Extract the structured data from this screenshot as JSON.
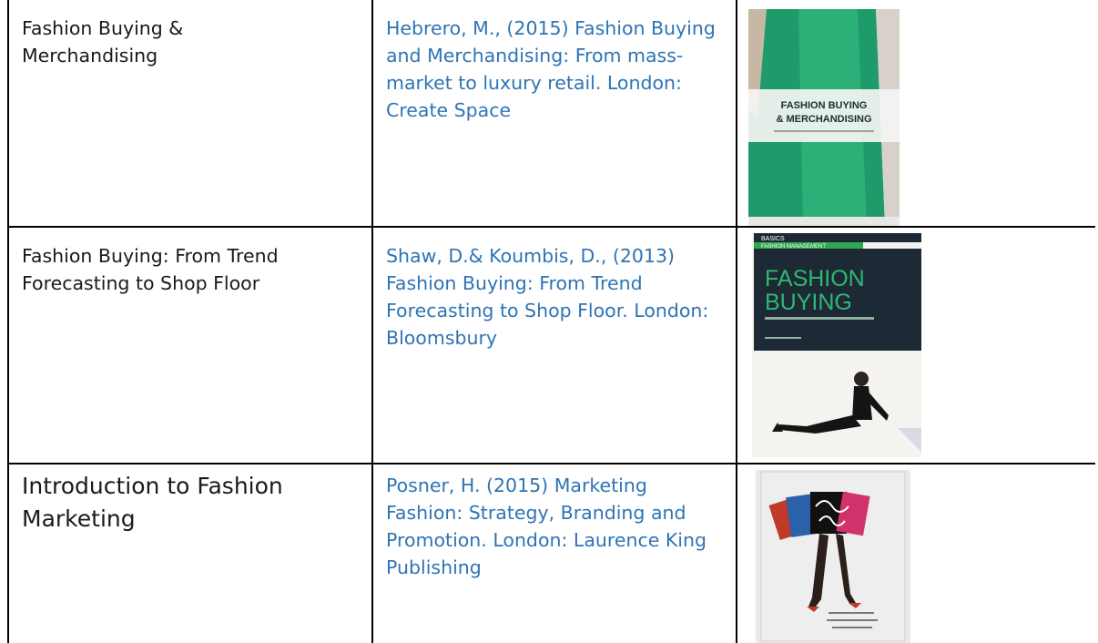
{
  "rows": [
    {
      "title": "Fashion Buying & Merchandising",
      "reference": "Hebrero, M., (2015) Fashion Buying and Merchandising: From mass-market to luxury retail. London: Create Space",
      "cover": {
        "icon": "book-cover-image",
        "title_line1": "FASHION BUYING",
        "title_line2": "& MERCHANDISING",
        "primary_color": "#1f9a6a"
      }
    },
    {
      "title": "Fashion Buying: From Trend Forecasting to Shop Floor",
      "reference": "Shaw, D.& Koumbis, D., (2013) Fashion Buying: From Trend Forecasting to Shop Floor. London: Bloomsbury",
      "cover": {
        "icon": "book-cover-image",
        "series": "BASICS",
        "series_sub": "FASHION MANAGEMENT",
        "title_line1": "FASHION",
        "title_line2": "BUYING",
        "primary_color": "#1d2a36",
        "accent_color": "#2fa84f"
      }
    },
    {
      "title": "Introduction to Fashion Marketing",
      "reference": "Posner, H. (2015) Marketing Fashion: Strategy, Branding and Promotion. London: Laurence King Publishing",
      "cover": {
        "icon": "book-cover-image",
        "primary_color": "#e9e9e9",
        "accent_color": "#c0392b"
      }
    }
  ]
}
